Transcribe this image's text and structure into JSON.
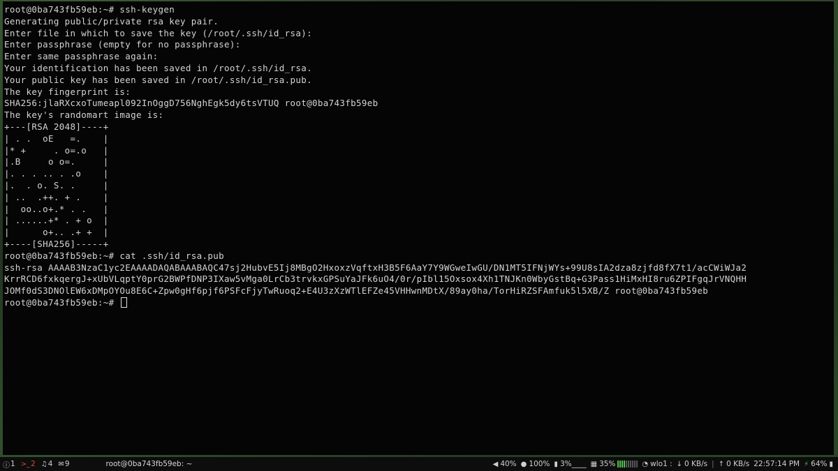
{
  "terminal": {
    "lines": [
      "root@0ba743fb59eb:~# ssh-keygen",
      "Generating public/private rsa key pair.",
      "Enter file in which to save the key (/root/.ssh/id_rsa):",
      "Enter passphrase (empty for no passphrase):",
      "Enter same passphrase again:",
      "Your identification has been saved in /root/.ssh/id_rsa.",
      "Your public key has been saved in /root/.ssh/id_rsa.pub.",
      "The key fingerprint is:",
      "SHA256:jlaRXcxoTumeapl092InOggD756NghEgk5dy6tsVTUQ root@0ba743fb59eb",
      "The key's randomart image is:",
      "+---[RSA 2048]----+",
      "| . .  oE   =.    |",
      "|* +     . o=.o   |",
      "|.B     o o=.     |",
      "|. . . .. . .o    |",
      "|.  . o. S. .     |",
      "| ..  .++. + .    |",
      "|  oo..o+.* . .   |",
      "| ......+* . + o  |",
      "|      o+.. .+ +  |",
      "+----[SHA256]-----+",
      "root@0ba743fb59eb:~# cat .ssh/id_rsa.pub",
      "ssh-rsa AAAAB3NzaC1yc2EAAAADAQABAAABAQC47sj2HubvE5Ij8MBgO2HxoxzVqftxH3B5F6AaY7Y9WGweIwGU/DN1MT5IFNjWYs+99U8sIA2dza8zjfd8fX7t1/acCWiWJa2",
      "KrrRCD6fxkqergJ+xUbVLqptY0prG2BWPfDNP3IXaw5vMga0LrCb3trvkxGPSuYaJFk6uO4/0r/pIbl15Oxsox4Xh1TNJKn0WbyGstBq+G3Pass1HiMxHI8ru6ZPIFgqJrVNQHH",
      "JOMf0dS3DNOlEW6xDMpOYOu8E6C+Zpw0gHf6pjf6PSFcFjyTwRuoq2+E4U3zXzWTlEFZe45VHHwnMDtX/89ay0ha/TorHiRZSFAmfuk5l5XB/Z root@0ba743fb59eb"
    ],
    "prompt": "root@0ba743fb59eb:~# "
  },
  "statusbar": {
    "workspaces": [
      {
        "icon": "info-circle-icon",
        "glyph": "ⓘ",
        "label": "1",
        "urgent": false
      },
      {
        "icon": "terminal-icon",
        "glyph": ">_",
        "label": "2",
        "urgent": true
      },
      {
        "icon": "music-icon",
        "glyph": "♫",
        "label": "4",
        "urgent": false
      },
      {
        "icon": "mail-icon",
        "glyph": "✉",
        "label": "9",
        "urgent": false
      }
    ],
    "window_title": "root@0ba743fb59eb: ~",
    "volume": "40%",
    "brightness": "100%",
    "cpu": "3%",
    "cpu_graph": "____",
    "memory": "35%",
    "memory_level": 0.35,
    "network_iface": "wlo1 :",
    "download": "0 KB/s",
    "upload": "0 KB/s",
    "time": "22:57:14 PM",
    "battery": "64%"
  }
}
